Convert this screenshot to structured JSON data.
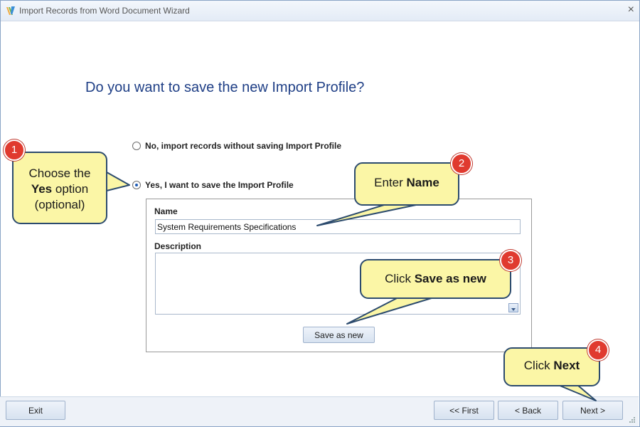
{
  "window": {
    "title": "Import Records from Word Document Wizard",
    "close_glyph": "×"
  },
  "main": {
    "heading": "Do you want to save the new Import Profile?",
    "options": [
      {
        "label": "No, import records without saving Import Profile",
        "checked": false
      },
      {
        "label": "Yes, I want to save the Import Profile",
        "checked": true
      }
    ],
    "name_label": "Name",
    "name_value": "System Requirements Specifications",
    "description_label": "Description",
    "description_value": "",
    "save_button": "Save as new"
  },
  "footer": {
    "exit": "Exit",
    "first": "<< First",
    "back": "< Back",
    "next": "Next >"
  },
  "callouts": [
    {
      "number": "1",
      "lines": [
        "Choose the",
        "Yes option",
        "(optional)"
      ],
      "bold": "Yes",
      "after_bold": "option"
    },
    {
      "number": "2",
      "prefix": "Enter",
      "bold": "Name"
    },
    {
      "number": "3",
      "prefix": "Click",
      "bold": "Save as new"
    },
    {
      "number": "4",
      "prefix": "Click",
      "bold": "Next"
    }
  ],
  "colors": {
    "heading": "#1f3f86",
    "callout_fill": "#fbf6a6",
    "callout_border": "#2c4b6e",
    "badge": "#e03a2f"
  },
  "icons": [
    "app-icon",
    "close-icon",
    "scroll-down-icon",
    "resize-grip-icon"
  ]
}
